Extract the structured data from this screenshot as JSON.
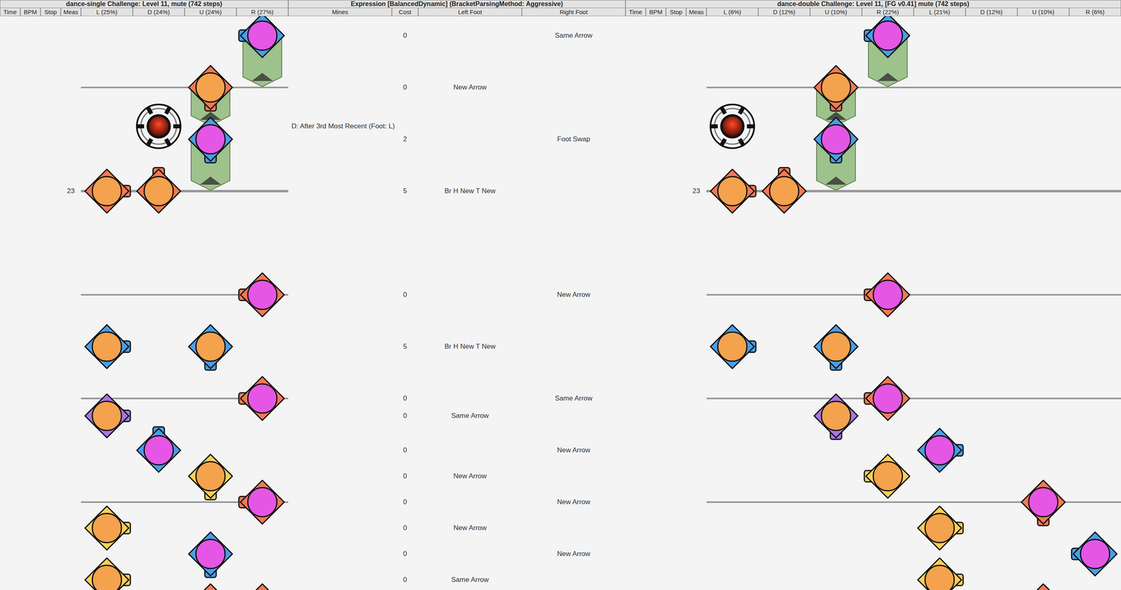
{
  "charts": [
    {
      "title": "dance-single Challenge: Level 11, mute (742 steps)",
      "columns": [
        "Time",
        "BPM",
        "Stop",
        "Meas",
        "L (25%)",
        "D (24%)",
        "U (24%)",
        "R (27%)"
      ],
      "measureLabel": {
        "row": 6,
        "text": "23"
      },
      "lines": [
        {
          "row": 2,
          "measure": false
        },
        {
          "row": 6,
          "measure": true
        },
        {
          "row": 10,
          "measure": false
        },
        {
          "row": 14,
          "measure": false
        },
        {
          "row": 18,
          "measure": false
        }
      ],
      "holds": [
        {
          "lane": 3,
          "start": 0,
          "end": 2
        },
        {
          "lane": 2,
          "start": 2,
          "end": 3.5
        },
        {
          "lane": 2,
          "start": 4,
          "end": 6
        }
      ],
      "mines": [
        {
          "lane": 1,
          "row": 3.5
        }
      ],
      "notes": [
        {
          "lane": 3,
          "row": 0,
          "foot": "right",
          "color": "#4a9ee8"
        },
        {
          "lane": 2,
          "row": 2,
          "foot": "left",
          "color": "#f07a55"
        },
        {
          "lane": 2,
          "row": 4,
          "foot": "right",
          "color": "#4a9ee8"
        },
        {
          "lane": 0,
          "row": 6,
          "foot": "left",
          "color": "#f07a55"
        },
        {
          "lane": 1,
          "row": 6,
          "foot": "left",
          "color": "#f07a55"
        },
        {
          "lane": 3,
          "row": 10,
          "foot": "right",
          "color": "#f07a55"
        },
        {
          "lane": 0,
          "row": 12,
          "foot": "left",
          "color": "#4a9ee8"
        },
        {
          "lane": 2,
          "row": 12,
          "foot": "left",
          "color": "#4a9ee8"
        },
        {
          "lane": 3,
          "row": 14,
          "foot": "right",
          "color": "#f07a55"
        },
        {
          "lane": 0,
          "row": 14.667,
          "foot": "left",
          "color": "#a877e0"
        },
        {
          "lane": 1,
          "row": 16,
          "foot": "right",
          "color": "#4a9ee8"
        },
        {
          "lane": 2,
          "row": 17,
          "foot": "left",
          "color": "#f5d05a"
        },
        {
          "lane": 3,
          "row": 18,
          "foot": "right",
          "color": "#f07a55"
        },
        {
          "lane": 0,
          "row": 19,
          "foot": "left",
          "color": "#f5d05a"
        },
        {
          "lane": 2,
          "row": 20,
          "foot": "right",
          "color": "#4a9ee8"
        },
        {
          "lane": 0,
          "row": 21,
          "foot": "left",
          "color": "#f5d05a"
        },
        {
          "lane": 2,
          "row": 22,
          "foot": "left",
          "color": "#f07a55"
        },
        {
          "lane": 3,
          "row": 22,
          "foot": "right",
          "color": "#f07a55"
        }
      ]
    },
    {
      "title": "dance-double Challenge: Level 11, [FG v0.41] mute (742 steps)",
      "columns": [
        "Time",
        "BPM",
        "Stop",
        "Meas",
        "L (6%)",
        "D (12%)",
        "U (10%)",
        "R (22%)",
        "L (21%)",
        "D (12%)",
        "U (10%)",
        "R (6%)"
      ],
      "measureLabel": {
        "row": 6,
        "text": "23"
      },
      "lines": [
        {
          "row": 2,
          "measure": false
        },
        {
          "row": 6,
          "measure": true
        },
        {
          "row": 10,
          "measure": false
        },
        {
          "row": 14,
          "measure": false
        },
        {
          "row": 18,
          "measure": false
        }
      ],
      "holds": [
        {
          "lane": 3,
          "start": 0,
          "end": 2
        },
        {
          "lane": 2,
          "start": 2,
          "end": 3.5
        },
        {
          "lane": 2,
          "start": 4,
          "end": 6
        }
      ],
      "mines": [
        {
          "lane": 0,
          "row": 3.5
        }
      ],
      "notes": [
        {
          "lane": 3,
          "row": 0,
          "foot": "right",
          "color": "#4a9ee8"
        },
        {
          "lane": 2,
          "row": 2,
          "foot": "left",
          "color": "#f07a55"
        },
        {
          "lane": 2,
          "row": 4,
          "foot": "right",
          "color": "#4a9ee8"
        },
        {
          "lane": 0,
          "row": 6,
          "foot": "left",
          "color": "#f07a55"
        },
        {
          "lane": 1,
          "row": 6,
          "foot": "left",
          "color": "#f07a55"
        },
        {
          "lane": 3,
          "row": 10,
          "foot": "right",
          "color": "#f07a55"
        },
        {
          "lane": 0,
          "row": 12,
          "foot": "left",
          "color": "#4a9ee8"
        },
        {
          "lane": 2,
          "row": 12,
          "foot": "left",
          "color": "#4a9ee8"
        },
        {
          "lane": 3,
          "row": 14,
          "foot": "right",
          "color": "#f07a55"
        },
        {
          "lane": 2,
          "row": 14.667,
          "foot": "left",
          "color": "#a877e0"
        },
        {
          "lane": 4,
          "row": 16,
          "foot": "right",
          "color": "#4a9ee8"
        },
        {
          "lane": 3,
          "row": 17,
          "foot": "left",
          "color": "#f5d05a"
        },
        {
          "lane": 6,
          "row": 18,
          "foot": "right",
          "color": "#f07a55"
        },
        {
          "lane": 4,
          "row": 19,
          "foot": "left",
          "color": "#f5d05a"
        },
        {
          "lane": 7,
          "row": 20,
          "foot": "right",
          "color": "#4a9ee8"
        },
        {
          "lane": 4,
          "row": 21,
          "foot": "left",
          "color": "#f5d05a"
        },
        {
          "lane": 6,
          "row": 22,
          "foot": "right",
          "color": "#f07a55"
        }
      ]
    }
  ],
  "expression": {
    "title": "Expression [BalancedDynamic] (BracketParsingMethod: Aggressive)",
    "columns": [
      "Mines",
      "Cost",
      "Left Foot",
      "Right Foot"
    ],
    "rows": [
      {
        "row": 0,
        "mines": "",
        "cost": "0",
        "left": "",
        "right": "Same Arrow"
      },
      {
        "row": 2,
        "mines": "",
        "cost": "0",
        "left": "New Arrow",
        "right": ""
      },
      {
        "row": 3.5,
        "mines": "D: After 3rd Most Recent (Foot: L)",
        "cost": "",
        "left": "",
        "right": ""
      },
      {
        "row": 4,
        "mines": "",
        "cost": "2",
        "left": "",
        "right": "Foot Swap"
      },
      {
        "row": 6,
        "mines": "",
        "cost": "5",
        "left": "Br H New T New",
        "right": ""
      },
      {
        "row": 10,
        "mines": "",
        "cost": "0",
        "left": "",
        "right": "New Arrow"
      },
      {
        "row": 12,
        "mines": "",
        "cost": "5",
        "left": "Br H New T New",
        "right": ""
      },
      {
        "row": 14,
        "mines": "",
        "cost": "0",
        "left": "",
        "right": "Same Arrow"
      },
      {
        "row": 14.667,
        "mines": "",
        "cost": "0",
        "left": "Same Arrow",
        "right": ""
      },
      {
        "row": 16,
        "mines": "",
        "cost": "0",
        "left": "",
        "right": "New Arrow"
      },
      {
        "row": 17,
        "mines": "",
        "cost": "0",
        "left": "New Arrow",
        "right": ""
      },
      {
        "row": 18,
        "mines": "",
        "cost": "0",
        "left": "",
        "right": "New Arrow"
      },
      {
        "row": 19,
        "mines": "",
        "cost": "0",
        "left": "New Arrow",
        "right": ""
      },
      {
        "row": 20,
        "mines": "",
        "cost": "0",
        "left": "",
        "right": "New Arrow"
      },
      {
        "row": 21,
        "mines": "",
        "cost": "0",
        "left": "Same Arrow",
        "right": ""
      }
    ]
  }
}
